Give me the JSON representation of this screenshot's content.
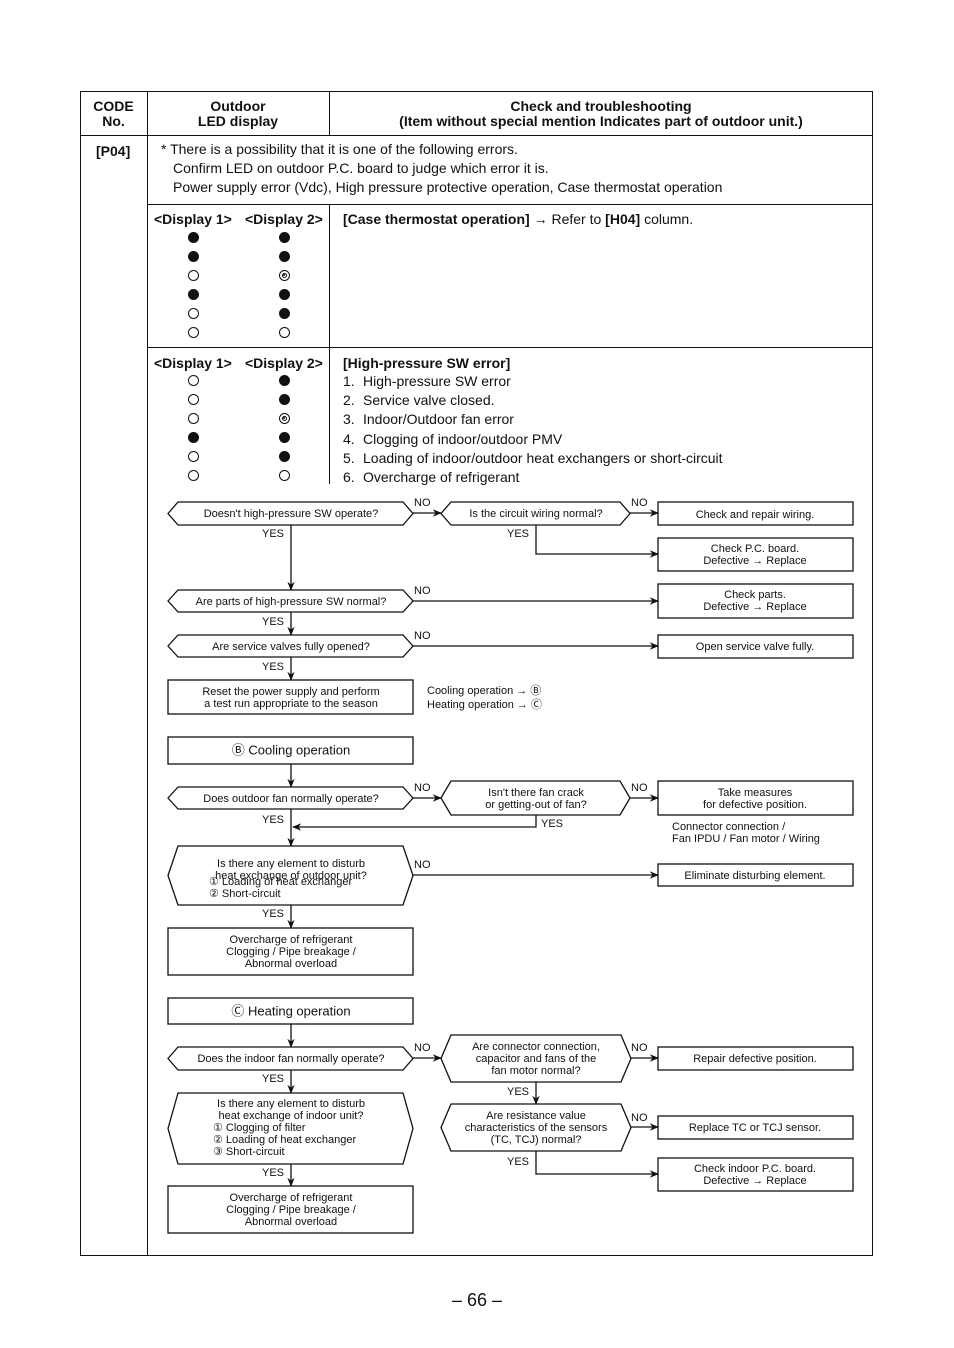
{
  "table_header": {
    "code_line1": "CODE",
    "code_line2": "No.",
    "led_line1": "Outdoor",
    "led_line2": "LED display",
    "check_line1": "Check and troubleshooting",
    "check_line2": "(Item without special mention Indicates part of outdoor unit.)"
  },
  "code": "[P04]",
  "intro_notes": [
    "* There is a possibility that it is one of the following errors.",
    "Confirm LED on outdoor P.C. board to judge which error it is.",
    "Power supply error (Vdc), High pressure protective operation, Case thermostat operation"
  ],
  "display_labels": {
    "d1": "<Display 1>",
    "d2": "<Display 2>"
  },
  "led_legend": {
    "on": "filled circle = lit",
    "off": "open circle = off",
    "blink": "double circle = flashing"
  },
  "case_thermostat": {
    "title": "[Case thermostat operation]",
    "arrow": " → Refer to ",
    "ref": "[H04]",
    "suffix": " column.",
    "display1": [
      "on",
      "on",
      "off",
      "on",
      "off",
      "off"
    ],
    "display2": [
      "on",
      "on",
      "blink",
      "on",
      "on",
      "off"
    ]
  },
  "high_pressure": {
    "title": "[High-pressure SW error]",
    "items": [
      {
        "n": "1.",
        "t": "High-pressure SW error"
      },
      {
        "n": "2.",
        "t": "Service valve closed."
      },
      {
        "n": "3.",
        "t": "Indoor/Outdoor fan error"
      },
      {
        "n": "4.",
        "t": "Clogging of indoor/outdoor PMV"
      },
      {
        "n": "5.",
        "t": "Loading of indoor/outdoor heat exchangers or short-circuit"
      },
      {
        "n": "6.",
        "t": "Overcharge of refrigerant"
      }
    ],
    "display1": [
      "off",
      "off",
      "off",
      "on",
      "off",
      "off"
    ],
    "display2": [
      "on",
      "on",
      "blink",
      "on",
      "on",
      "off"
    ]
  },
  "flow": {
    "yes": "YES",
    "no": "NO",
    "q1": "Doesn't high-pressure SW operate?",
    "q1b": "Is the circuit wiring normal?",
    "a_wiring": "Check and repair wiring.",
    "a_pcb": [
      "Check P.C. board.",
      "Defective → Replace"
    ],
    "q2": "Are parts of high-pressure SW normal?",
    "a_parts": [
      "Check parts.",
      "Defective → Replace"
    ],
    "q3": "Are service valves fully opened?",
    "a_valve": "Open service valve fully.",
    "reset": [
      "Reset the power supply and  perform",
      "a test run appropriate to the season"
    ],
    "season": [
      "Cooling operation → Ⓑ",
      "Heating operation → Ⓒ"
    ],
    "cooling_title": "Ⓑ  Cooling operation",
    "c_q1": "Does outdoor fan normally operate?",
    "c_q1b": [
      "Isn't there fan crack",
      "or getting-out of fan?"
    ],
    "c_a_measures": [
      "Take measures",
      "for defective position."
    ],
    "c_a_note": [
      "Connector connection /",
      "Fan IPDU / Fan motor / Wiring"
    ],
    "c_q2": [
      "Is there any element to disturb",
      "heat exchange of outdoor unit?",
      "① Loading of heat exchanger",
      "② Short-circuit"
    ],
    "c_a_elim": "Eliminate disturbing element.",
    "c_result": [
      "Overcharge of refrigerant",
      "Clogging / Pipe breakage /",
      "Abnormal overload"
    ],
    "heating_title": "Ⓒ  Heating operation",
    "h_q1": "Does the indoor fan normally operate?",
    "h_q1b": [
      "Are connector connection,",
      "capacitor and fans of the",
      "fan motor normal?"
    ],
    "h_a_repair": "Repair defective position.",
    "h_q1c": [
      "Are resistance value",
      "characteristics of the sensors",
      "(TC, TCJ) normal?"
    ],
    "h_a_sensor": "Replace TC or TCJ sensor.",
    "h_a_pcb": [
      "Check indoor P.C. board.",
      "Defective → Replace"
    ],
    "h_q2": [
      "Is there any element to disturb",
      "heat exchange of indoor unit?",
      "① Clogging of filter",
      "② Loading of heat exchanger",
      "③ Short-circuit"
    ],
    "h_result": [
      "Overcharge of refrigerant",
      "Clogging / Pipe breakage /",
      "Abnormal overload"
    ]
  },
  "page_number": "– 66 –"
}
